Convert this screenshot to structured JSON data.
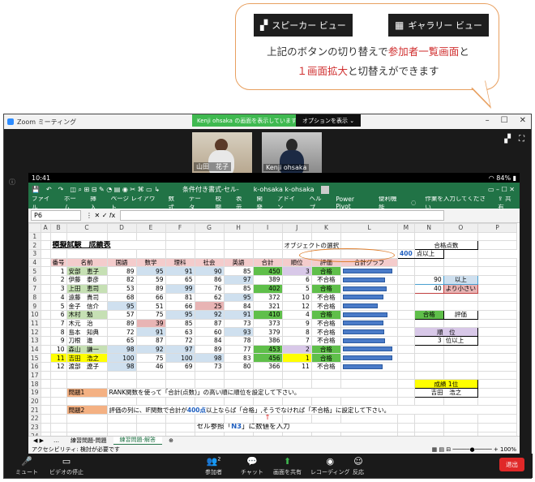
{
  "callout": {
    "speaker_btn": "スピーカー ビュー",
    "gallery_btn": "ギャラリー ビュー",
    "line1_a": "上記のボタンの切り替えで",
    "line1_b": "参加者一覧画面",
    "line1_c": "と",
    "line2_a": "１画面拡大",
    "line2_b": "と切替えができます"
  },
  "zoom": {
    "title": "Zoom ミーティング",
    "share_banner": "Kenji ohsaka の画面を表示しています",
    "options": "オプションを表示 ⌄",
    "participants": [
      {
        "name": "山田　花子"
      },
      {
        "name": "Kenji ohsaka"
      }
    ],
    "toolbar": {
      "mute": "ミュート",
      "video": "ビデオの停止",
      "participants": "参加者",
      "participants_count": "2",
      "chat": "チャット",
      "share": "画面を共有",
      "record": "レコーディング",
      "reactions": "反応",
      "leave": "退出"
    }
  },
  "device": {
    "time": "10:41",
    "battery": "84%"
  },
  "excel": {
    "doc_title": "条件付き書式-セル-",
    "user": "k-ohsaka k-ohsaka",
    "menu": [
      "ファイル",
      "ホーム",
      "挿入",
      "ページ レイアウト",
      "数式",
      "データ",
      "校閲",
      "表示",
      "開発",
      "アドイン",
      "ヘルプ",
      "Power Pivot",
      "便利機能"
    ],
    "tell_me": "作業を入力してください",
    "share": "共有",
    "name_box": "P6",
    "columns": [
      "A",
      "B",
      "C",
      "D",
      "E",
      "F",
      "G",
      "H",
      "I",
      "J",
      "K",
      "L",
      "M",
      "N",
      "O",
      "P"
    ],
    "sheet_title": "模擬試験　成績表",
    "object_select": "オブジェクトの選択",
    "headers": [
      "番号",
      "名前",
      "国語",
      "数学",
      "理科",
      "社会",
      "英語",
      "合計",
      "順位",
      "評価",
      "合計グラフ"
    ],
    "rows": [
      [
        "1",
        "安部　恵子",
        "89",
        "95",
        "91",
        "90",
        "85",
        "450",
        "3",
        "合格"
      ],
      [
        "2",
        "伊藤　泰彦",
        "82",
        "59",
        "65",
        "86",
        "97",
        "389",
        "6",
        "不合格"
      ],
      [
        "3",
        "上田　恵司",
        "53",
        "89",
        "99",
        "76",
        "85",
        "402",
        "5",
        "合格"
      ],
      [
        "4",
        "遠藤　貴司",
        "68",
        "66",
        "81",
        "62",
        "95",
        "372",
        "10",
        "不合格"
      ],
      [
        "5",
        "金子　信介",
        "95",
        "51",
        "66",
        "25",
        "84",
        "321",
        "12",
        "不合格"
      ],
      [
        "6",
        "木村　勉",
        "57",
        "75",
        "95",
        "92",
        "91",
        "410",
        "4",
        "合格"
      ],
      [
        "7",
        "木元　治",
        "89",
        "39",
        "85",
        "87",
        "73",
        "373",
        "9",
        "不合格"
      ],
      [
        "8",
        "島本　知典",
        "72",
        "91",
        "63",
        "60",
        "93",
        "379",
        "8",
        "不合格"
      ],
      [
        "9",
        "刀根　進",
        "65",
        "87",
        "72",
        "84",
        "78",
        "386",
        "7",
        "不合格"
      ],
      [
        "10",
        "森山　謙一",
        "98",
        "92",
        "97",
        "89",
        "77",
        "453",
        "2",
        "合格"
      ],
      [
        "11",
        "吉田　浩之",
        "100",
        "75",
        "100",
        "98",
        "83",
        "456",
        "1",
        "合格"
      ],
      [
        "12",
        "渡部　遼子",
        "98",
        "46",
        "69",
        "73",
        "80",
        "366",
        "11",
        "不合格"
      ]
    ],
    "side": {
      "pass_points_label": "合格点数",
      "pass_points_value": "400",
      "pass_points_unit": "点以上",
      "r6_value": "90",
      "r6_unit": "以上",
      "r7_value": "40",
      "r7_unit": "より小さい",
      "pass_label": "合格",
      "eval_label": "評価",
      "rank_label": "順　位",
      "rank_value": "3",
      "rank_unit": "位以上",
      "top_label": "成績 1位",
      "top_name": "吉田　浩之"
    },
    "q1_label": "問題1",
    "q1_text": "RANK関数を使って「合計(点数)」の高い順に順位を設定して下さい。",
    "q2_label": "問題2",
    "q2_text_a": "評価の列に、IF関数で合計が",
    "q2_text_b": "400点",
    "q2_text_c": "以上ならば「合格」,そうでなければ「不合格」に設定して下さい。",
    "note_a": "セル参照「",
    "note_b": "N3",
    "note_c": "」に数値を入力",
    "tabs": [
      "練習問題-問題",
      "練習問題-解答"
    ],
    "status_left": "アクセシビリティ: 検討が必要です",
    "zoom_level": "100%"
  },
  "colors": {
    "excel_green": "#217346",
    "bar_blue": "#4a7bc8",
    "callout_border": "#e8a060",
    "leave_red": "#e02828"
  }
}
